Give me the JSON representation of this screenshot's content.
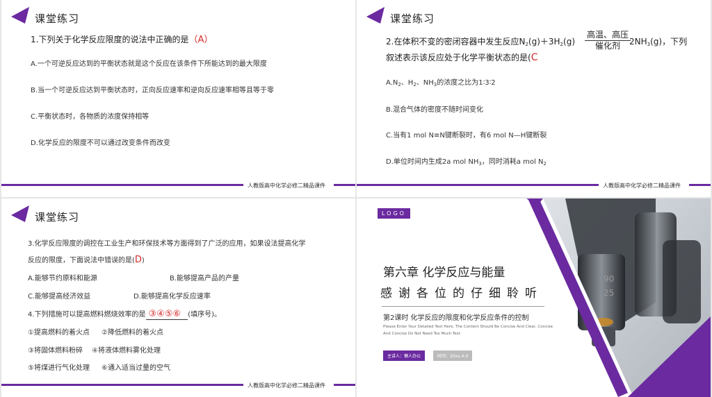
{
  "section_title": "课堂练习",
  "footer": "人教版高中化学必修二精品课件",
  "slide1": {
    "question": "1.下列关于化学反应限度的说法中正确的是",
    "answer": "（A）",
    "options": [
      "A.一个可逆反应达到的平衡状态就是这个反应在该条件下所能达到的最大限度",
      "B.当一个可逆反应达到平衡状态时，正向反应速率和逆向反应速率相等且等于零",
      "C.平衡状态时，各物质的浓度保持相等",
      "D.化学反应的限度不可以通过改变条件而改变"
    ]
  },
  "slide2": {
    "q_prefix": "2.在体积不变的密闭容器中发生反应N",
    "q_mid1": "(g)＋3H",
    "q_mid2": "(g)",
    "q_right": "2NH",
    "q_end": "(g)，下列",
    "q_line2": "叙述表示该反应处于化学平衡状态的是(",
    "q_line2_end": ")",
    "answer": "C",
    "cond_top": "高温、高压",
    "cond_bottom": "催化剂",
    "sub2": "2",
    "sub3": "3",
    "opt_a": "A.N",
    "opt_a2": "、H",
    "opt_a3": "、NH",
    "opt_a4": "的浓度之比为1∶3∶2",
    "opt_b": "B.混合气体的密度不随时间变化",
    "opt_c": "C.当有1 mol N≡N键断裂时，有6 mol N—H键断裂",
    "opt_d1": "D.单位时间内生成2a mol NH",
    "opt_d2": "，同时消耗a mol N"
  },
  "slide3": {
    "q3_line1": "3.化学反应限度的调控在工业生产和环保技术等方面得到了广泛的应用，如果设法提高化学",
    "q3_line2": "反应的限度，下面说法中错误的是(",
    "q3_answer": "D",
    "q3_close": ")",
    "options": [
      "A.能够节约原料和能源",
      "B.能够提高产品的产量",
      "C.能够提高经济效益",
      "D.能够提高化学反应速率"
    ],
    "q4": "4.下列措施可以提高燃料燃烧效率的是",
    "q4_answer": "③④⑤⑥",
    "q4_end": "(填序号)。",
    "items": [
      "①提高燃料的着火点",
      "②降低燃料的着火点",
      "③将固体燃料粉碎",
      "④将液体燃料雾化处理",
      "⑤将煤进行气化处理",
      "⑥通入适当过量的空气"
    ]
  },
  "slide4": {
    "logo": "LOGO",
    "chapter": "第六章  化学反应与能量",
    "thanks": "感谢各位的仔细聆听",
    "lesson": "第2课时   化学反应的限度和化学反应条件的控制",
    "en1": "Please Enter Your Detailed Text Here, The Content Should Be Concise And Clear, Concise",
    "en2": "And Concise Do Not Need Too Much Text",
    "presenter": "主讲人：懒人办公",
    "time": "时间：20xx.4.4",
    "lens_mark1": "90",
    "lens_mark2": "25",
    "colors": {
      "accent": "#6b2aa0",
      "answer": "#d42a2a"
    }
  }
}
